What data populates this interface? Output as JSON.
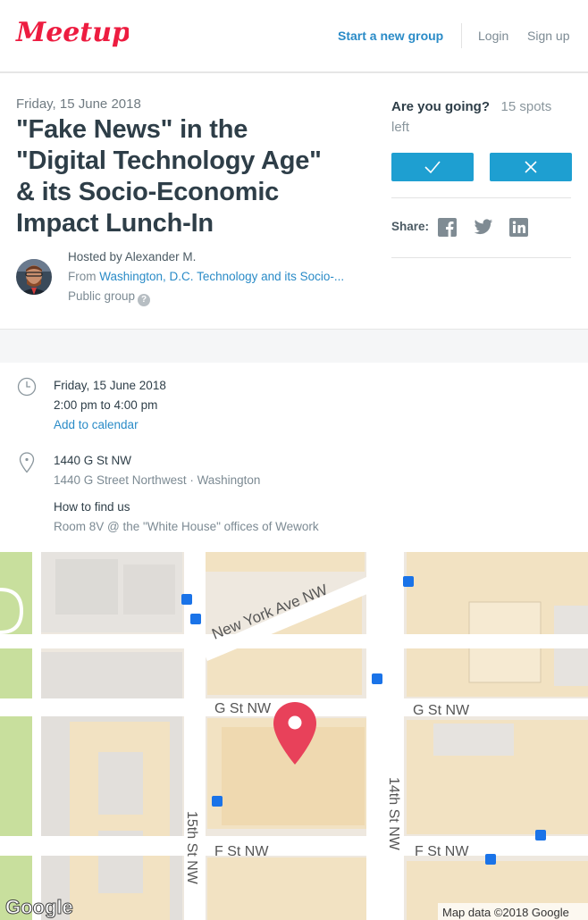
{
  "header": {
    "logo_text": "Meetup",
    "start_group_label": "Start a new group",
    "login_label": "Login",
    "signup_label": "Sign up"
  },
  "event": {
    "date": "Friday, 15 June 2018",
    "title_lines": [
      "\"Fake News\" in the",
      "\"Digital Technology Age\"",
      "& its Socio-Economic",
      "Impact Lunch-In"
    ],
    "hosted_by": "Hosted by Alexander M.",
    "from_prefix": "From",
    "group_link": "Washington, D.C. Technology and its Socio-...",
    "public_group": "Public group"
  },
  "rsvp": {
    "question": "Are you going?",
    "spots": "15 spots left",
    "share_label": "Share:"
  },
  "details": {
    "date": "Friday, 15 June 2018",
    "time": "2:00 pm to 4:00 pm",
    "add_calendar": "Add to calendar",
    "venue": "1440 G St NW",
    "address": "1440 G Street Northwest · Washington",
    "how_to_find_label": "How to find us",
    "how_to_find": "Room 8V @ the \"White House\" offices of Wework"
  },
  "map": {
    "streets": {
      "ny_ave": "New York Ave NW",
      "g_st_left": "G St NW",
      "g_st_right": "G St NW",
      "f_st_left": "F St NW",
      "f_st_right": "F St NW",
      "st15": "15th St NW",
      "st14": "14th St NW"
    },
    "google_logo": "Google",
    "attribution": "Map data ©2018 Google"
  },
  "colors": {
    "brand": "#ed1c40",
    "link": "#2a8bc7",
    "rsvp_button": "#1e9fd1",
    "pin": "#e8415a"
  }
}
